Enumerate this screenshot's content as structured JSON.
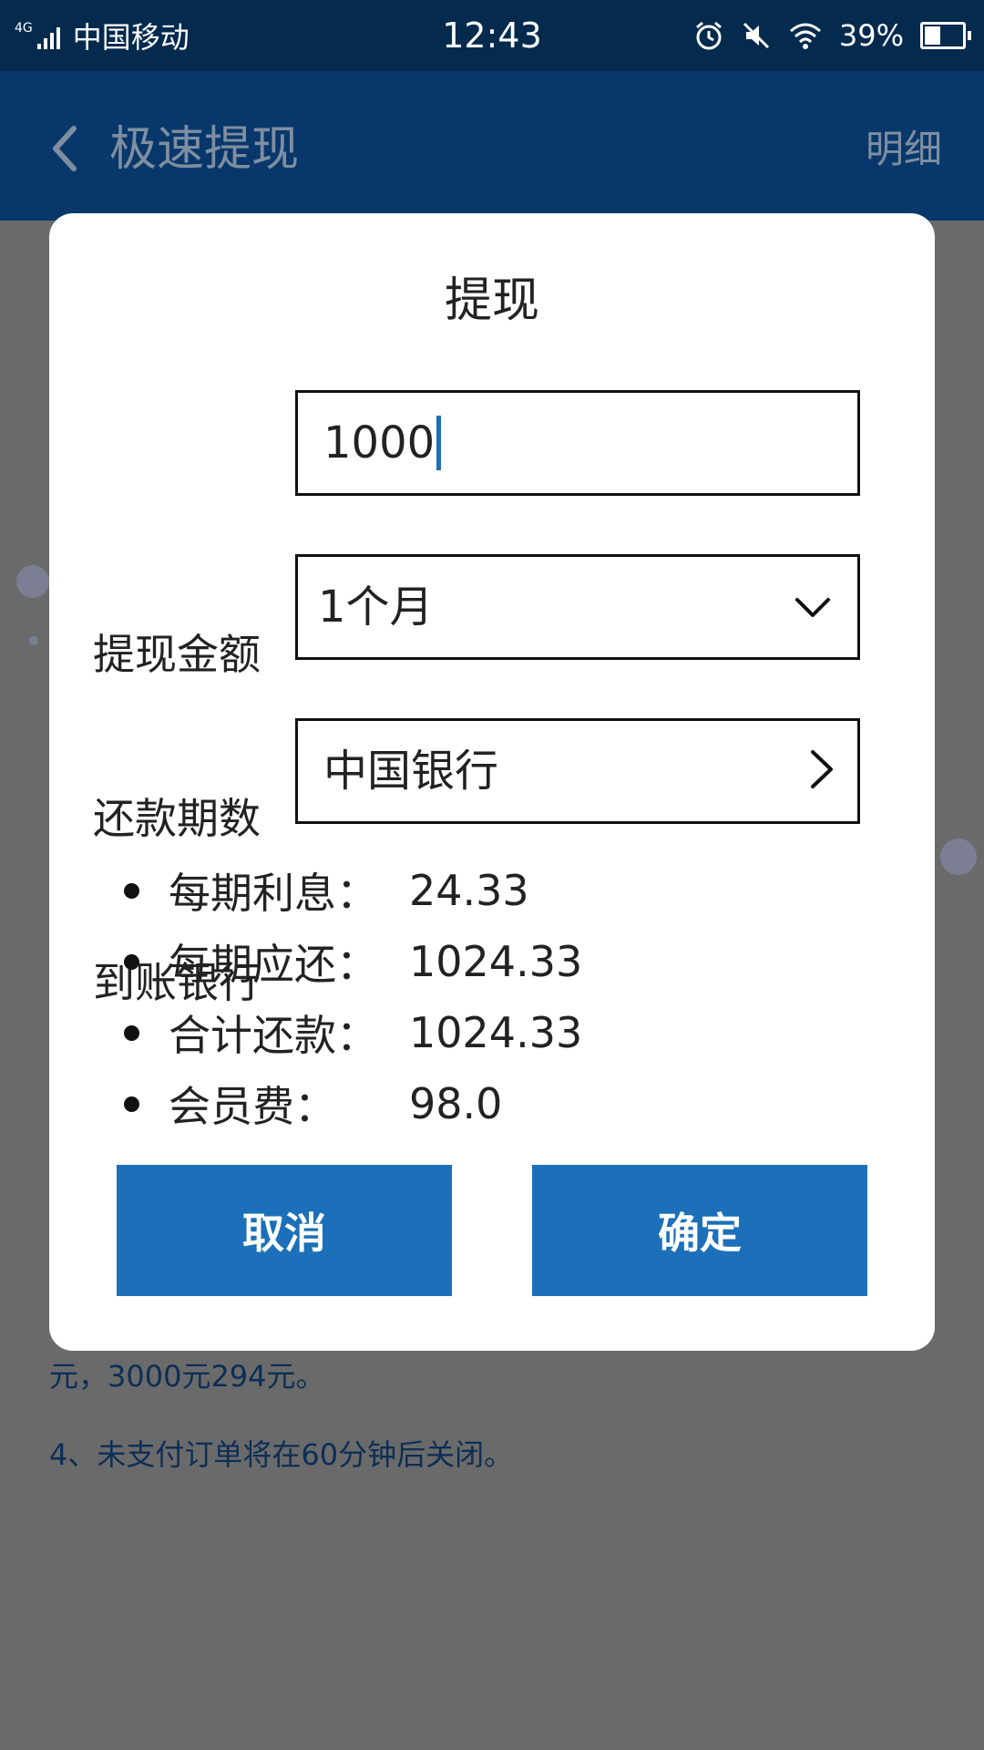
{
  "status_bar": {
    "network": "4G",
    "carrier": "中国移动",
    "time": "12:43",
    "battery": "39%"
  },
  "app_bar": {
    "title": "极速提现",
    "detail_link": "明细"
  },
  "background": {
    "note_line1": "元，3000元294元。",
    "note_line2": "4、未支付订单将在60分钟后关闭。"
  },
  "dialog": {
    "title": "提现",
    "amount": {
      "label": "提现金额",
      "value": "1000"
    },
    "installments": {
      "label": "还款期数",
      "value": "1个月"
    },
    "bank": {
      "label": "到账银行",
      "value": "中国银行"
    },
    "details": [
      {
        "label": "每期利息：",
        "value": "24.33"
      },
      {
        "label": "每期应还：",
        "value": "1024.33"
      },
      {
        "label": "合计还款：",
        "value": "1024.33"
      },
      {
        "label": "会员费：",
        "value": "98.0"
      }
    ],
    "cancel_label": "取消",
    "confirm_label": "确定"
  },
  "colors": {
    "status_bar": "#042a4e",
    "app_bar": "#08386b",
    "overlay": "#6a6a6a",
    "button": "#1c70b9",
    "cursor": "#1b6fb8"
  },
  "icons": [
    "signal-icon",
    "alarm-icon",
    "mute-icon",
    "wifi-icon",
    "battery-icon",
    "back-arrow-icon",
    "chevron-down-icon",
    "chevron-right-icon"
  ]
}
